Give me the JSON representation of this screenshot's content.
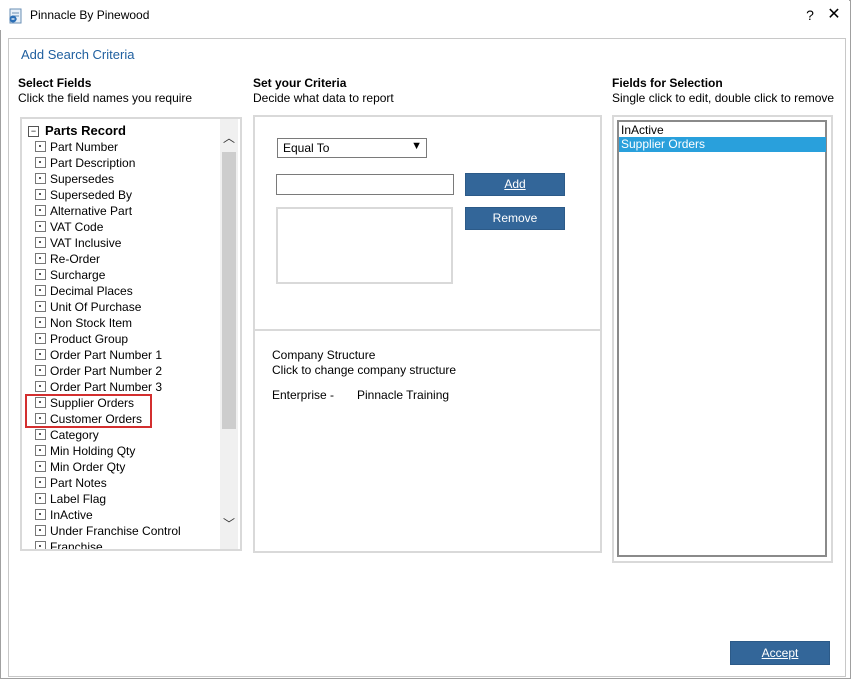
{
  "window": {
    "title": "Pinnacle By Pinewood",
    "help_label": "?",
    "close_label": "✕",
    "icon": "pinnacle-app-icon"
  },
  "header": {
    "title": "Add Search Criteria"
  },
  "select_fields": {
    "title": "Select Fields",
    "subtitle": "Click the field names you require",
    "root_label": "Parts Record",
    "root_expander": "−",
    "items": [
      "Part Number",
      "Part Description",
      "Supersedes",
      "Superseded By",
      "Alternative Part",
      "VAT Code",
      "VAT Inclusive",
      "Re-Order",
      "Surcharge",
      "Decimal Places",
      "Unit Of Purchase",
      "Non Stock Item",
      "Product Group",
      "Order Part Number 1",
      "Order Part Number 2",
      "Order Part Number 3",
      "Supplier Orders",
      "Customer Orders",
      "Category",
      "Min Holding Qty",
      "Min Order Qty",
      "Part Notes",
      "Label Flag",
      "InActive",
      "Under Franchise Control",
      "Franchise"
    ],
    "scroll_up": "︿",
    "scroll_down": "﹀"
  },
  "criteria": {
    "title": "Set your Criteria",
    "subtitle": "Decide what data to report",
    "operator_value": "Equal To",
    "operator_arrow": "▼",
    "value_input": "",
    "value_placeholder": "",
    "add_label": "Add",
    "remove_label": "Remove"
  },
  "company": {
    "title": "Company Structure",
    "subtitle": "Click to change company structure",
    "enterprise_label": "Enterprise -",
    "enterprise_value": "Pinnacle Training"
  },
  "selection": {
    "title": "Fields for Selection",
    "subtitle": "Single click to edit, double click to remove",
    "items": [
      "InActive",
      "Supplier Orders"
    ],
    "selected_index": 1
  },
  "footer": {
    "accept_label": "Accept"
  },
  "colors": {
    "accent": "#336699",
    "selected": "#29a0dc",
    "highlight": "#d32f2f",
    "link": "#1f5f9f"
  }
}
